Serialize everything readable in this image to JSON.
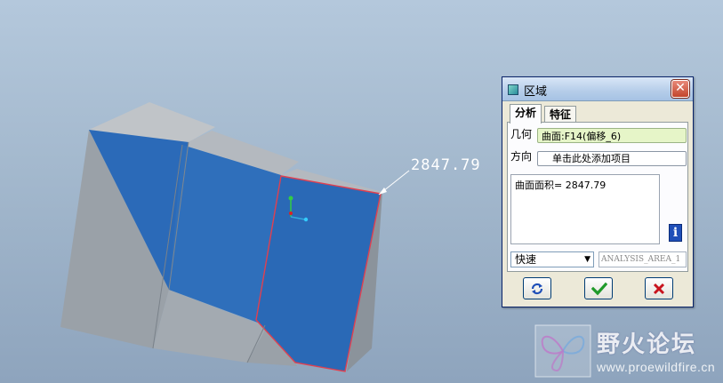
{
  "viewport": {
    "dimension_label": "2847.79",
    "colors": {
      "surface_blue": "#2b6ab8",
      "body_gray": "#9aa3ab",
      "edge_red": "#e04050"
    }
  },
  "dialog": {
    "title": "区域",
    "tabs": [
      {
        "label": "分析",
        "active": true
      },
      {
        "label": "特征",
        "active": false
      }
    ],
    "geometry_label": "几何",
    "geometry_value": "曲面:F14(偏移_6)",
    "direction_label": "方向",
    "direction_value": "单击此处添加项目",
    "result_text": "曲面面积= 2847.79",
    "mode_select": {
      "selected": "快速"
    },
    "analysis_name": "ANALYSIS_AREA_1",
    "icons": {
      "title": "window-icon",
      "close": "close-icon",
      "info": "info-icon",
      "repeat": "repeat-icon",
      "ok": "checkmark-icon",
      "cancel": "x-icon"
    }
  },
  "watermark": {
    "title": "野火论坛",
    "url": "www.proewildfire.cn"
  }
}
